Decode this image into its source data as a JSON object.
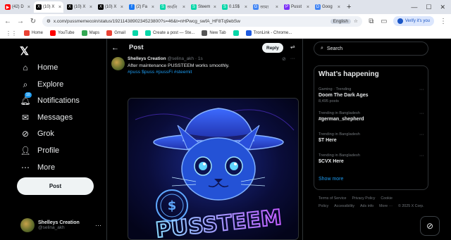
{
  "browser": {
    "tabs": [
      {
        "label": "(42) D",
        "icon": "youtube-icon",
        "color": "#ff0000",
        "glyph": "▶"
      },
      {
        "label": "(10) X",
        "icon": "x-icon",
        "color": "#000000",
        "glyph": "X",
        "active": true
      },
      {
        "label": "(10) X",
        "icon": "x-icon",
        "color": "#000000",
        "glyph": "X"
      },
      {
        "label": "(10) X",
        "icon": "x-icon",
        "color": "#000000",
        "glyph": "X"
      },
      {
        "label": "(2) Fa",
        "icon": "facebook-icon",
        "color": "#1877f2",
        "glyph": "f"
      },
      {
        "label": "অর্থনি",
        "icon": "steemit-icon",
        "color": "#07d7a9",
        "glyph": "S"
      },
      {
        "label": "Steem",
        "icon": "steemit-icon",
        "color": "#07d7a9",
        "glyph": "S"
      },
      {
        "label": "0.15$",
        "icon": "steemit-icon",
        "color": "#07d7a9",
        "glyph": "S"
      },
      {
        "label": "আমা",
        "icon": "google-icon",
        "color": "#4285f4",
        "glyph": "G"
      },
      {
        "label": "Pusst",
        "icon": "pusst-icon",
        "color": "#7b2ff7",
        "glyph": "P"
      },
      {
        "label": "Goog",
        "icon": "docs-icon",
        "color": "#4285f4",
        "glyph": "D"
      }
    ],
    "new_tab": "+",
    "url": "x.com/pussmemecoin/status/1921143890234523800?s=46&t=nHPwcg_swfA_HF8Tq9ebSw",
    "translate_hint": "English",
    "verify_label": "Verify it's you",
    "bookmarks": [
      {
        "label": "Home",
        "icon": "google-home-icon",
        "color": "#ea4335"
      },
      {
        "label": "YouTube",
        "icon": "youtube-icon",
        "color": "#ff0000"
      },
      {
        "label": "Maps",
        "icon": "maps-icon",
        "color": "#34a853"
      },
      {
        "label": "Gmail",
        "icon": "gmail-icon",
        "color": "#ea4335"
      },
      {
        "label": "",
        "icon": "steemit-icon",
        "color": "#07d7a9"
      },
      {
        "label": "Create a post — Ste...",
        "icon": "steemit-icon",
        "color": "#07d7a9"
      },
      {
        "label": "New Tab",
        "icon": "new-tab-icon",
        "color": "#555555"
      },
      {
        "label": "",
        "icon": "steemit-icon",
        "color": "#07d7a9"
      },
      {
        "label": "TronLink - Chrome...",
        "icon": "tronlink-icon",
        "color": "#1e5be0"
      }
    ]
  },
  "nav": {
    "items": [
      {
        "label": "Home",
        "icon": "home-icon",
        "glyph": "⌂"
      },
      {
        "label": "Explore",
        "icon": "explore-search-icon",
        "glyph": "⌕"
      },
      {
        "label": "Notifications",
        "icon": "bell-icon",
        "glyph": "🔔︎",
        "badge": "10"
      },
      {
        "label": "Messages",
        "icon": "envelope-icon",
        "glyph": "✉"
      },
      {
        "label": "Grok",
        "icon": "grok-icon",
        "glyph": "⊘"
      },
      {
        "label": "Profile",
        "icon": "person-icon",
        "glyph": "👤︎"
      },
      {
        "label": "More",
        "icon": "more-circle-icon",
        "glyph": "⋯"
      }
    ],
    "post_label": "Post",
    "account": {
      "name": "Shelleys Creation",
      "handle": "@selina_akh"
    }
  },
  "main": {
    "title": "Post",
    "reply_label": "Reply",
    "tweet": {
      "author": "Shelleys Creation",
      "handle": "@selina_akh",
      "age": "· 1s",
      "text": "After maintenance PUSSTEEM works smoothly.",
      "hashtags": "#puss $puss #pussFi #steemit",
      "image_caption": "PUSSTEEM"
    }
  },
  "sidebar": {
    "search_placeholder": "Search",
    "trends_title": "What’s happening",
    "trends": [
      {
        "context": "Gaming · Trending",
        "name": "Doom The Dark Ages",
        "count": "8,495 posts"
      },
      {
        "context": "Trending in Bangladesh",
        "name": "#german_shepherd",
        "count": ""
      },
      {
        "context": "Trending in Bangladesh",
        "name": "$T Here",
        "count": ""
      },
      {
        "context": "Trending in Bangladesh",
        "name": "$CVX Here",
        "count": ""
      }
    ],
    "show_more": "Show more",
    "footer": [
      "Terms of Service",
      "Privacy Policy",
      "Cookie Policy",
      "Accessibility",
      "Ads info",
      "More ···",
      "© 2025 X Corp."
    ]
  },
  "colors": {
    "accent": "#1d9bf0",
    "background": "#000000",
    "border": "#2f3336",
    "muted": "#71767b"
  }
}
